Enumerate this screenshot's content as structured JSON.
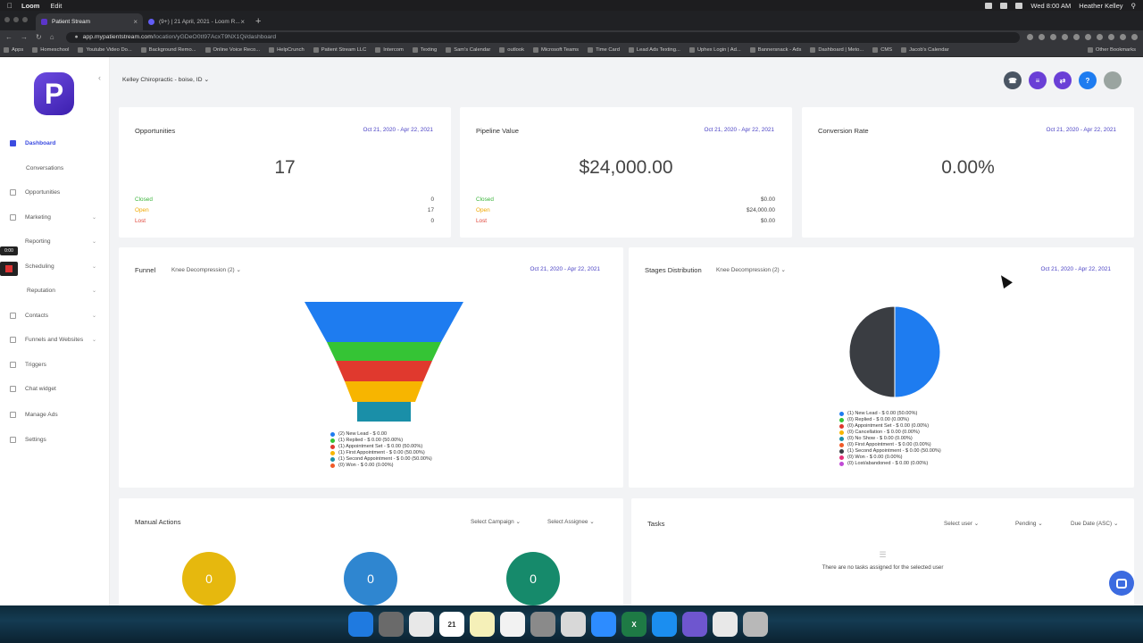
{
  "menubar": {
    "app": "Loom",
    "menu": "Edit",
    "clock": "Wed 8:00 AM",
    "user": "Heather Kelley"
  },
  "browser": {
    "tabs": [
      {
        "label": "Patient Stream"
      },
      {
        "label": "(9+) | 21 April, 2021 - Loom R..."
      }
    ],
    "url_host": "app.mypatientstream.com",
    "url_path": "/location/yGDeO0tI97AcxT9NX1Qi/dashboard",
    "bookmarks": [
      "Apps",
      "Homeschool",
      "Youtube Video Do...",
      "Background Remo...",
      "Online Voice Reco...",
      "HelpCrunch",
      "Patient Stream LLC",
      "Intercom",
      "Texting",
      "Sam's Calendar",
      "outlook",
      "Microsoft Teams",
      "Time Card",
      "Lead Ads Texting...",
      "Uphex Login | Ad...",
      "Bannersnack - Ads",
      "Dashboard | Meto...",
      "CMS",
      "Jacob's Calendar"
    ],
    "bookmarks_other": "Other Bookmarks"
  },
  "sidebar": {
    "logo": "P",
    "items": [
      {
        "label": "Dashboard",
        "active": true
      },
      {
        "label": "Conversations"
      },
      {
        "label": "Opportunities"
      },
      {
        "label": "Marketing",
        "chevron": true
      },
      {
        "label": "Reporting",
        "chevron": true
      },
      {
        "label": "Scheduling",
        "chevron": true
      },
      {
        "label": "Reputation",
        "chevron": true
      },
      {
        "label": "Contacts",
        "chevron": true
      },
      {
        "label": "Funnels and Websites",
        "chevron": true
      },
      {
        "label": "Triggers"
      },
      {
        "label": "Chat widget"
      },
      {
        "label": "Manage Ads"
      },
      {
        "label": "Settings"
      }
    ],
    "recorder_time": "0:00"
  },
  "header": {
    "location": "Kelley Chiropractic - boise, ID"
  },
  "cards": {
    "opportunities": {
      "title": "Opportunities",
      "date": "Oct 21, 2020 - Apr 22, 2021",
      "value": "17",
      "rows": [
        {
          "label": "Closed",
          "value": "0",
          "color": "#3cb43c"
        },
        {
          "label": "Open",
          "value": "17",
          "color": "#f0a800"
        },
        {
          "label": "Lost",
          "value": "0",
          "color": "#e0453a"
        }
      ]
    },
    "pipeline": {
      "title": "Pipeline Value",
      "date": "Oct 21, 2020 - Apr 22, 2021",
      "value": "$24,000.00",
      "rows": [
        {
          "label": "Closed",
          "value": "$0.00",
          "color": "#3cb43c"
        },
        {
          "label": "Open",
          "value": "$24,000.00",
          "color": "#f0a800"
        },
        {
          "label": "Lost",
          "value": "$0.00",
          "color": "#e0453a"
        }
      ]
    },
    "conversion": {
      "title": "Conversion Rate",
      "date": "Oct 21, 2020 - Apr 22, 2021",
      "value": "0.00%"
    }
  },
  "funnel": {
    "title": "Funnel",
    "pipeline": "Knee Decompression (2)",
    "date": "Oct 21, 2020 - Apr 22, 2021",
    "legend": [
      {
        "label": "(2) New Lead - $ 0.00",
        "color": "#1e7cf0"
      },
      {
        "label": "(1) Replied - $ 0.00 (50.00%)",
        "color": "#35c435"
      },
      {
        "label": "(1) Appointment Set - $ 0.00 (50.00%)",
        "color": "#e0392e"
      },
      {
        "label": "(1) First Appointment - $ 0.00 (50.00%)",
        "color": "#f7b500"
      },
      {
        "label": "(1) Second Appointment - $ 0.00 (50.00%)",
        "color": "#1a8fa8"
      },
      {
        "label": "(0) Won - $ 0.00 (0.00%)",
        "color": "#f05a28"
      }
    ]
  },
  "stages": {
    "title": "Stages Distribution",
    "pipeline": "Knee Decompression (2)",
    "date": "Oct 21, 2020 - Apr 22, 2021",
    "legend": [
      {
        "label": "(1) New Lead - $ 0.00 (50.00%)",
        "color": "#1e7cf0"
      },
      {
        "label": "(0) Replied - $ 0.00 (0.00%)",
        "color": "#35c435"
      },
      {
        "label": "(0) Appointment Set - $ 0.00 (0.00%)",
        "color": "#e0392e"
      },
      {
        "label": "(0) Cancellation - $ 0.00 (0.00%)",
        "color": "#f7b500"
      },
      {
        "label": "(0) No Show - $ 0.00 (0.00%)",
        "color": "#1a8fa8"
      },
      {
        "label": "(0) First Appointment - $ 0.00 (0.00%)",
        "color": "#f05a28"
      },
      {
        "label": "(1) Second Appointment - $ 0.00 (50.00%)",
        "color": "#3a3d42"
      },
      {
        "label": "(0) Won - $ 0.00 (0.00%)",
        "color": "#e8307a"
      },
      {
        "label": "(0) Lost/abandoned - $ 0.00 (0.00%)",
        "color": "#c04ad6"
      }
    ]
  },
  "chart_data": {
    "type": "pie",
    "series": [
      {
        "name": "Stages Distribution",
        "values": [
          50,
          0,
          0,
          0,
          0,
          0,
          50,
          0,
          0
        ]
      }
    ],
    "categories": [
      "New Lead",
      "Replied",
      "Appointment Set",
      "Cancellation",
      "No Show",
      "First Appointment",
      "Second Appointment",
      "Won",
      "Lost/abandoned"
    ]
  },
  "manual": {
    "title": "Manual Actions",
    "campaign": "Select Campaign",
    "assignee": "Select Assignee",
    "counts": [
      {
        "value": "0",
        "color": "#e6b80e"
      },
      {
        "value": "0",
        "color": "#2f86d0"
      },
      {
        "value": "0",
        "color": "#168a6b"
      }
    ]
  },
  "tasks": {
    "title": "Tasks",
    "user": "Select user",
    "status": "Pending",
    "sort": "Due Date (ASC)",
    "empty": "There are no tasks assigned for the selected user"
  },
  "dock": [
    {
      "color": "#1f7ae0"
    },
    {
      "color": "#6a6a6a"
    },
    {
      "color": "#e8e8e8"
    },
    {
      "color": "#ffffff",
      "label": "21"
    },
    {
      "color": "#f5f0b8"
    },
    {
      "color": "#f2f2f2"
    },
    {
      "color": "#8a8a8a"
    },
    {
      "color": "#d8d8d8"
    },
    {
      "color": "#2d8cff"
    },
    {
      "color": "#1e7a45",
      "label": "X"
    },
    {
      "color": "#1b8ef0"
    },
    {
      "color": "#6e56cf"
    },
    {
      "color": "#e8e8e8"
    },
    {
      "color": "#b8b8b8"
    }
  ]
}
